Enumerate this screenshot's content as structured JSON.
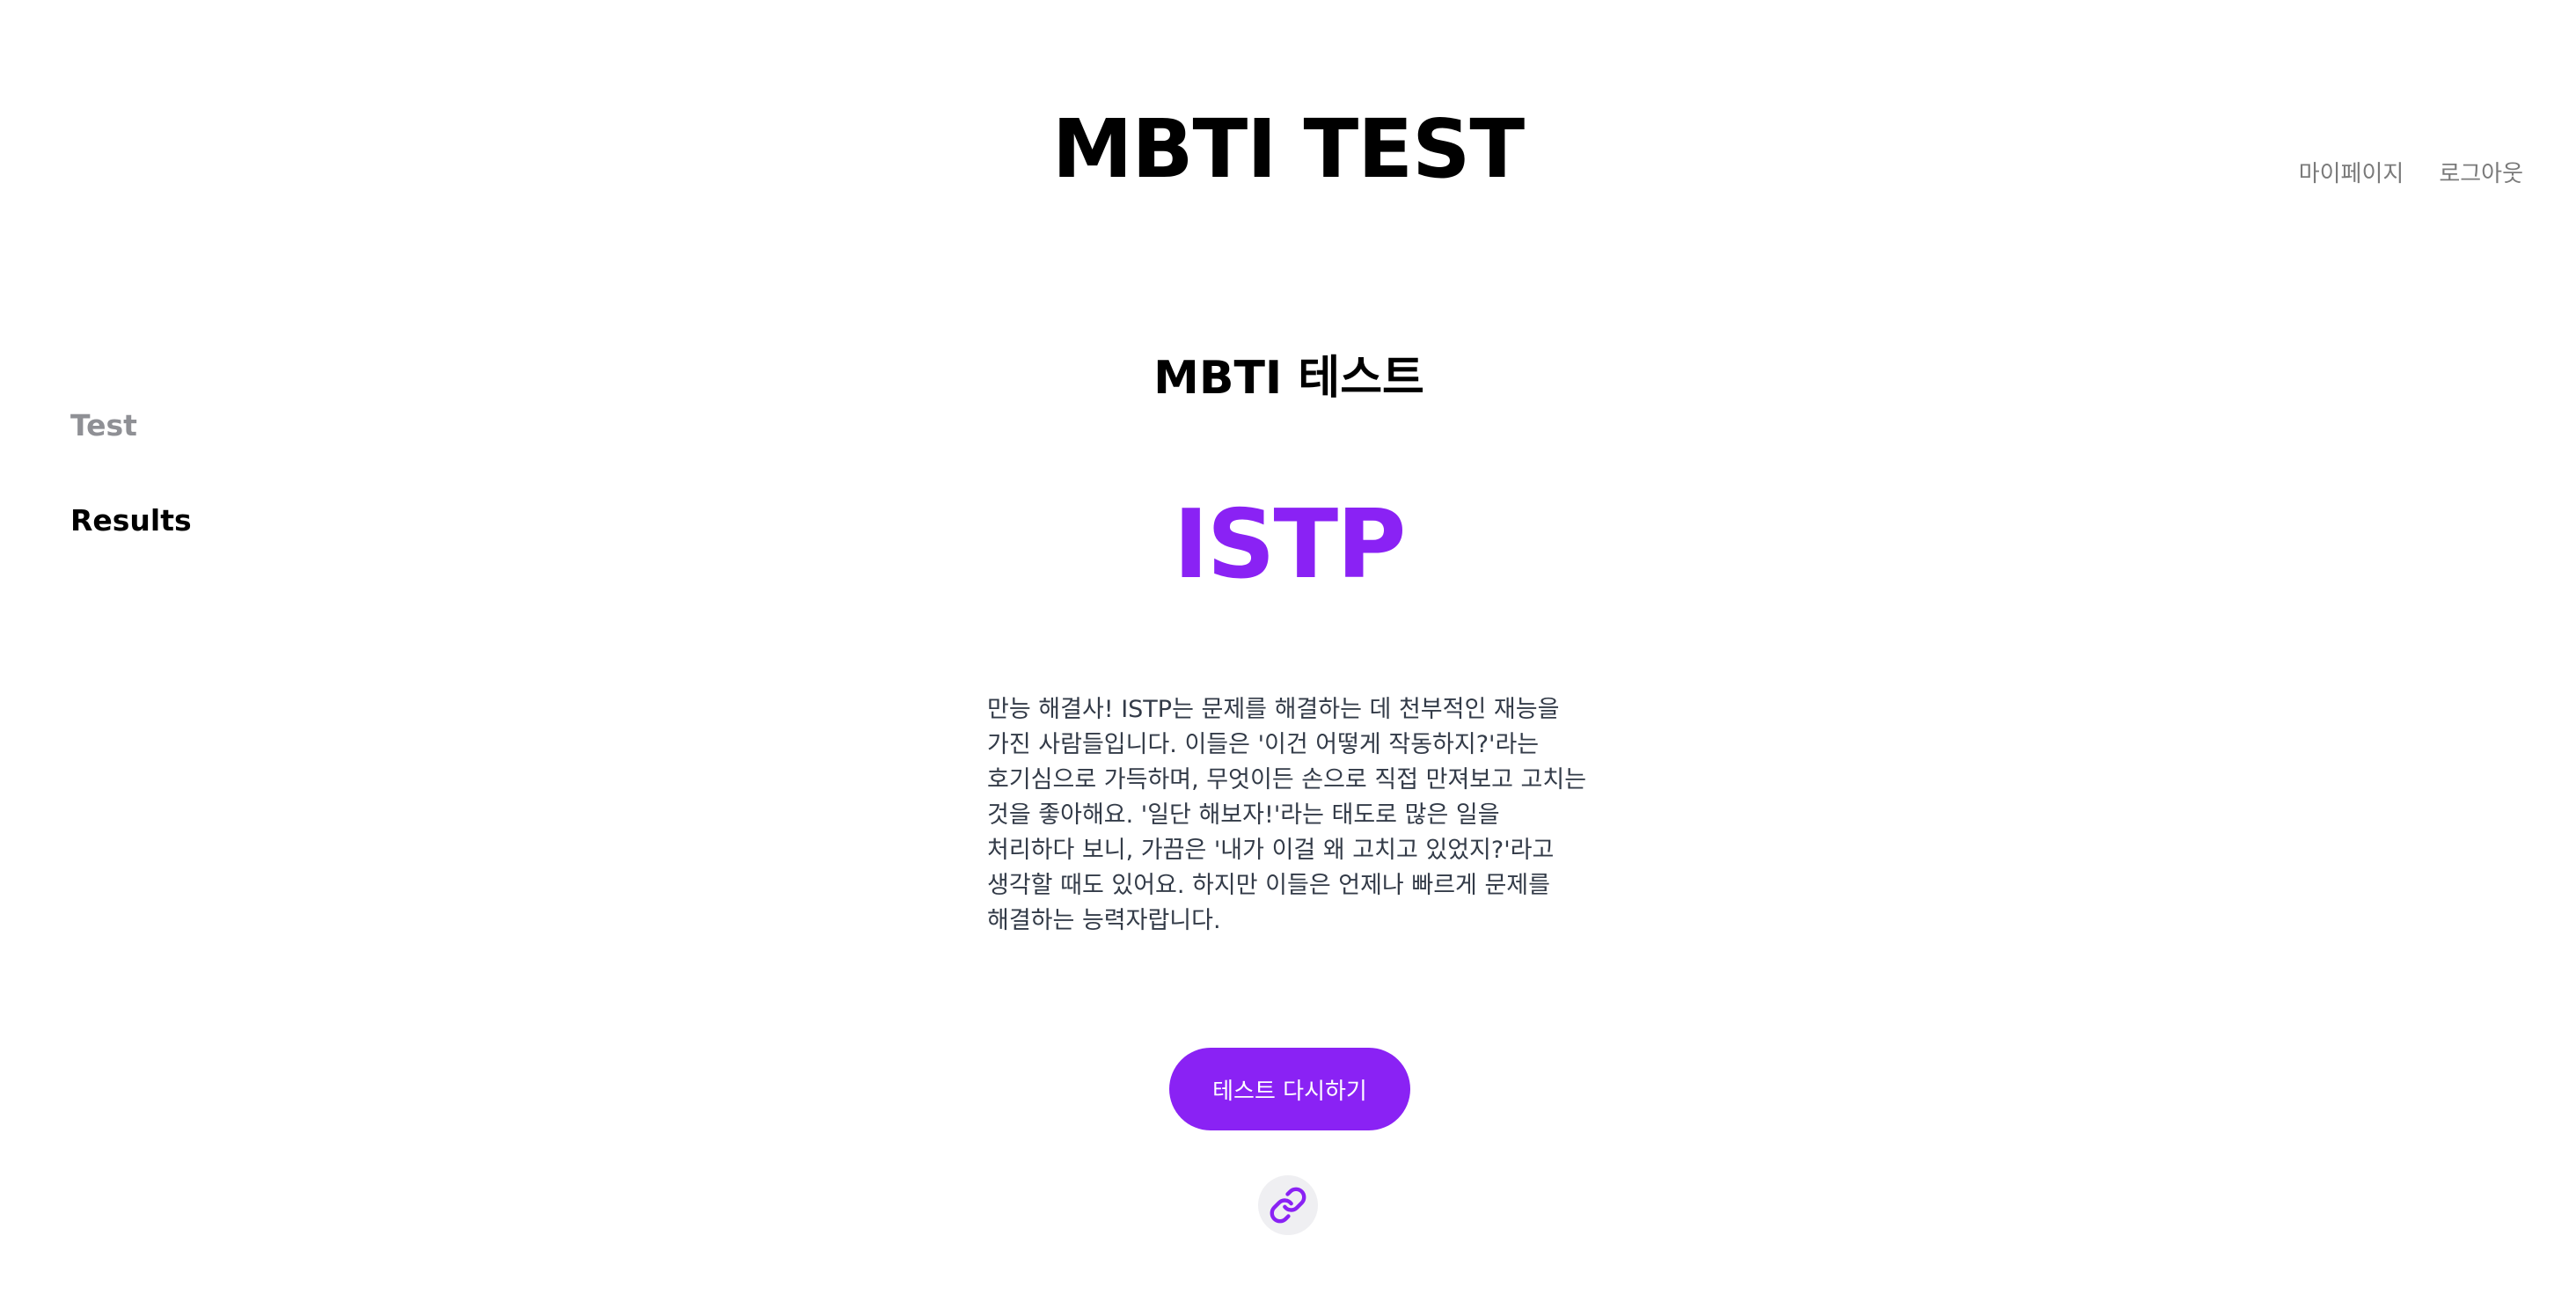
{
  "header": {
    "title": "MBTI TEST",
    "nav": {
      "mypage": "마이페이지",
      "logout": "로그아웃"
    }
  },
  "sidebar": {
    "items": [
      {
        "label": "Test",
        "state": "inactive"
      },
      {
        "label": "Results",
        "state": "active"
      }
    ]
  },
  "main": {
    "section_title": "MBTI 테스트",
    "result_type": "ISTP",
    "description": "만능 해결사! ISTP는 문제를 해결하는 데 천부적인 재능을 가진 사람들입니다. 이들은 '이건 어떻게 작동하지?'라는 호기심으로 가득하며, 무엇이든 손으로 직접 만져보고 고치는 것을 좋아해요. '일단 해보자!'라는 태도로 많은 일을 처리하다 보니, 가끔은 '내가 이걸 왜 고치고 있었지?'라고 생각할 때도 있어요. 하지만 이들은 언제나 빠르게 문제를 해결하는 능력자랍니다.",
    "retry_label": "테스트 다시하기",
    "share_icon": "link-icon"
  },
  "colors": {
    "accent": "#8a22f4",
    "muted_text": "#8f9095",
    "body_text": "#333b48",
    "icon_bg": "#efeff2"
  }
}
